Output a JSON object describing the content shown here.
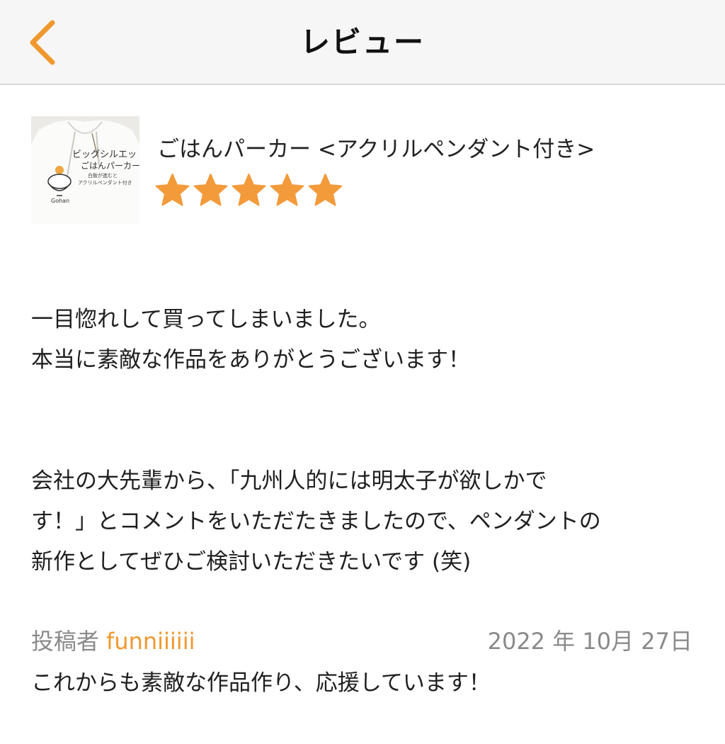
{
  "header": {
    "title": "レビュー",
    "back_icon": "chevron-left-icon"
  },
  "colors": {
    "accent": "#f0982e",
    "star": "#f39a3a",
    "muted": "#8a8a8a",
    "header_bg": "#f6f6f6"
  },
  "product": {
    "name": "ごはんパーカー <アクリルペンダント付き>",
    "thumbnail": {
      "line1": "ビッグシルエット",
      "line2": "ごはんパーカー",
      "line3": "白飯が進むと",
      "line4": "アクリルペンダント付き",
      "logo": "Gohan"
    },
    "rating": 5,
    "rating_max": 5
  },
  "review": {
    "paragraph1": "一目惚れして買ってしまいました。\n本当に素敵な作品をありがとうございます！",
    "paragraph2": "会社の大先輩から、「九州人的には明太子が欲しかで\nす！」とコメントをいただたきましたので、ペンダントの\n新作としてぜひご検討いただきたいです (笑)",
    "paragraph3": "これからも素敵な作品作り、応援しています！"
  },
  "footer": {
    "author_label": "投稿者",
    "author_name": "funniiiiii",
    "date": "2022 年 10月 27日"
  }
}
